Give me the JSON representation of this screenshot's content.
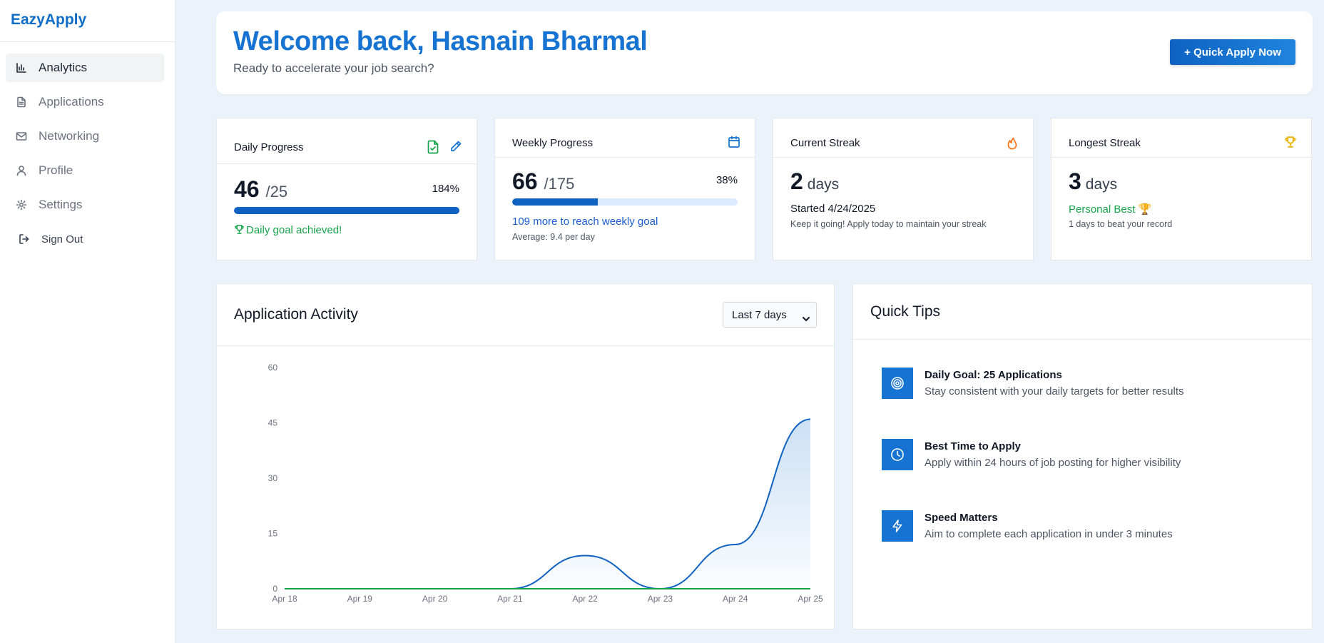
{
  "app": {
    "name": "EazyApply"
  },
  "sidebar": {
    "items": [
      {
        "label": "Analytics",
        "icon": "bar-chart-icon",
        "active": true
      },
      {
        "label": "Applications",
        "icon": "document-icon"
      },
      {
        "label": "Networking",
        "icon": "mail-icon"
      },
      {
        "label": "Profile",
        "icon": "user-icon"
      },
      {
        "label": "Settings",
        "icon": "gear-icon"
      }
    ],
    "signout": {
      "label": "Sign Out",
      "icon": "logout-icon"
    }
  },
  "header": {
    "title": "Welcome back, Hasnain Bharmal",
    "subtitle": "Ready to accelerate your job search?",
    "quick_apply_label": "+ Quick Apply Now"
  },
  "stats": {
    "daily": {
      "title": "Daily Progress",
      "value": "46",
      "goal": "/25",
      "percent": "184%",
      "progress": 1.0,
      "note": "Daily goal achieved!",
      "icons": [
        "file-check-icon",
        "pencil-icon"
      ]
    },
    "weekly": {
      "title": "Weekly Progress",
      "value": "66",
      "goal": "/175",
      "percent": "38%",
      "progress": 0.38,
      "note": "109 more to reach weekly goal",
      "sub_note": "Average: 9.4 per day",
      "icon": "calendar-icon"
    },
    "current": {
      "title": "Current Streak",
      "value": "2",
      "unit": "days",
      "line": "Started 4/24/2025",
      "sub_note": "Keep it going! Apply today to maintain your streak",
      "icon": "flame-icon"
    },
    "longest": {
      "title": "Longest Streak",
      "value": "3",
      "unit": "days",
      "line": "Personal Best 🏆",
      "sub_note": "1 days to beat your record",
      "icon": "trophy-icon"
    }
  },
  "activity": {
    "title": "Application Activity",
    "range": "Last 7 days"
  },
  "chart_data": {
    "type": "area",
    "title": "",
    "categories": [
      "Apr 18",
      "Apr 19",
      "Apr 20",
      "Apr 21",
      "Apr 22",
      "Apr 23",
      "Apr 24",
      "Apr 25"
    ],
    "series": [
      {
        "values": [
          0,
          0,
          0,
          0,
          9,
          0,
          12,
          46
        ],
        "color": "#0f62c2"
      },
      {
        "values": [
          0,
          0,
          0,
          0,
          0,
          0,
          0,
          0
        ],
        "color": "#16a34a"
      }
    ],
    "yticks": [
      0,
      15,
      30,
      45,
      60
    ],
    "ylim": [
      0,
      60
    ],
    "grid": false
  },
  "tips": {
    "title": "Quick Tips",
    "items": [
      {
        "title": "Daily Goal: 25 Applications",
        "desc": "Stay consistent with your daily targets for better results",
        "icon": "target-icon"
      },
      {
        "title": "Best Time to Apply",
        "desc": "Apply within 24 hours of job posting for higher visibility",
        "icon": "clock-icon"
      },
      {
        "title": "Speed Matters",
        "desc": "Aim to complete each application in under 3 minutes",
        "icon": "lightning-icon"
      }
    ]
  },
  "colors": {
    "brand": "#1673d1",
    "success": "#16a34a",
    "flame": "#f97316",
    "trophy": "#eab308"
  }
}
